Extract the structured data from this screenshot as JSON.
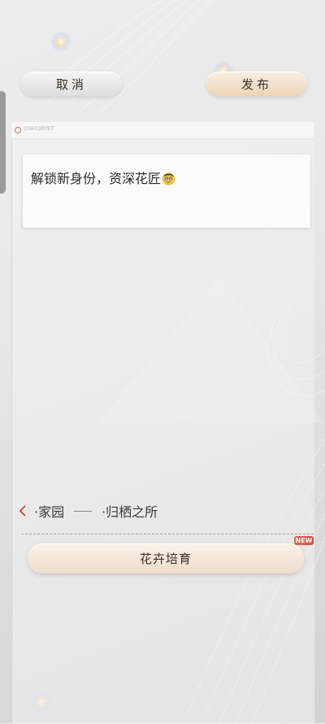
{
  "header": {
    "cancel_label": "取消",
    "publish_label": "发布"
  },
  "panel": {
    "logo_text": "ЗЛАТОЙЛЕТ"
  },
  "post": {
    "text": "解锁新身份，资深花匠",
    "emoji": "nerd-face-emoji"
  },
  "breadcrumb": {
    "back_icon": "chevron-left-icon",
    "item1": "·家园",
    "item2": "·归栖之所"
  },
  "feature": {
    "button_label": "花卉培育",
    "badge": "NEW"
  },
  "colors": {
    "accent_red": "#d14b41",
    "publish_gold": "#ecd3b7"
  }
}
